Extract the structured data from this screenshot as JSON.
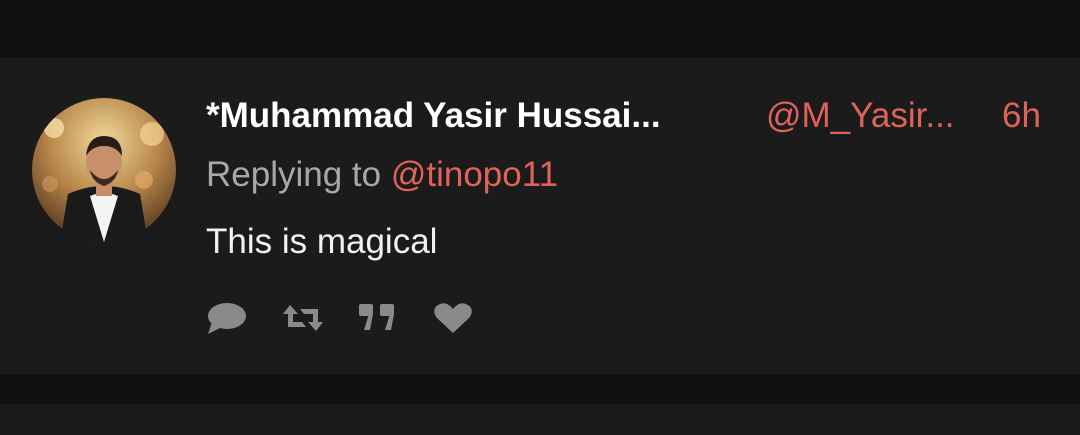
{
  "tweet": {
    "display_name": "*Muhammad Yasir Hussai...",
    "handle": "@M_Yasir...",
    "timestamp": "6h",
    "reply_prefix": "Replying to",
    "reply_mention": "@tinopo11",
    "text": "This is magical"
  },
  "actions": [
    {
      "icon": "reply-icon"
    },
    {
      "icon": "retweet-icon"
    },
    {
      "icon": "quote-icon"
    },
    {
      "icon": "like-icon"
    }
  ],
  "colors": {
    "background": "#111111",
    "card": "#1b1b1b",
    "accent": "#e0635a",
    "name": "#ffffff",
    "secondary_text": "#a8a8a8",
    "icon": "#8a8a8a"
  }
}
